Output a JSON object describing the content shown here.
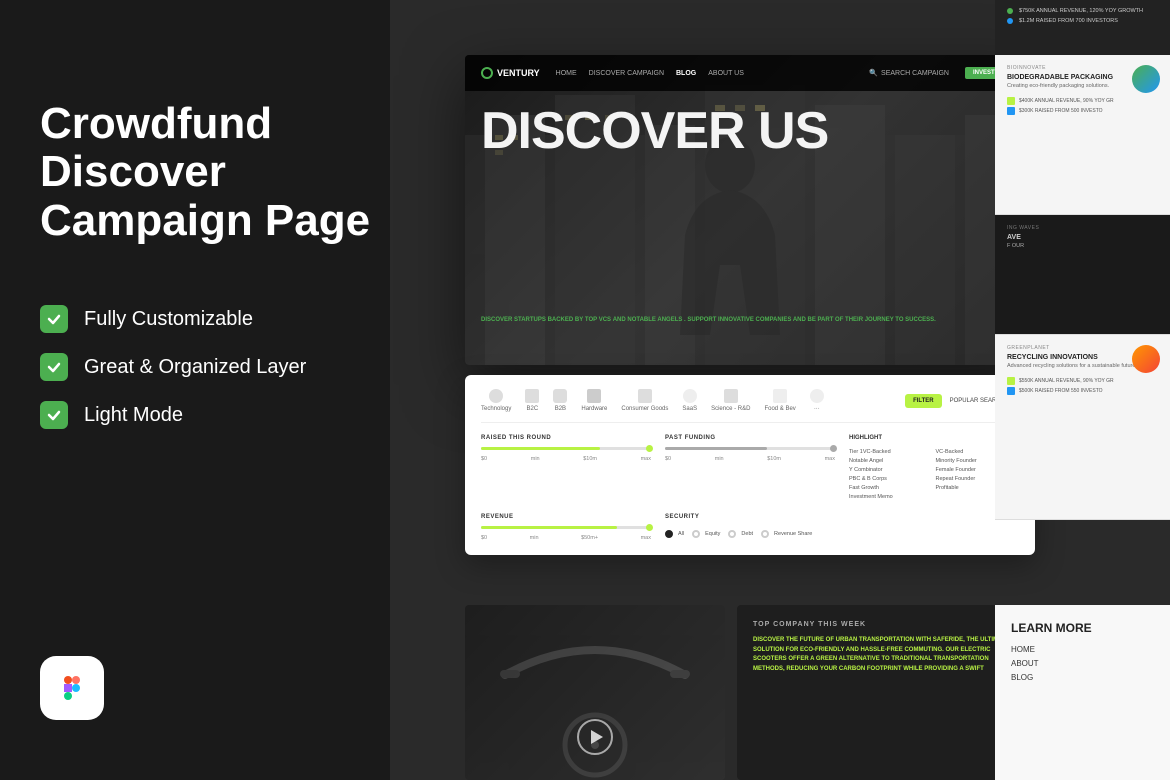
{
  "left": {
    "title": "Crowdfund\nDiscover\nCampaign Page",
    "features": [
      "Fully Customizable",
      "Great & Organized Layer",
      "Light Mode"
    ]
  },
  "hero": {
    "logo": "VENTURY",
    "nav_links": [
      "HOME",
      "DISCOVER CAMPAIGN",
      "BLOG",
      "ABOUT US"
    ],
    "search_placeholder": "SEARCH CAMPAIGN",
    "cta_button": "INVEST NOW",
    "title": "DISCOVER US",
    "subtitle_before": "DISCOVER STARTUPS BACKED BY",
    "highlight1": "TOP VCS",
    "connector": "AND",
    "highlight2": "NOTABLE ANGELS",
    "subtitle_after": ". SUPPORT INNOVATIVE COMPANIES AND BE PART OF THEIR JOURNEY TO SUCCESS."
  },
  "filter": {
    "tabs": [
      "Technology",
      "B2C",
      "B2B",
      "Hardware",
      "Consumer Goods",
      "SaaS",
      "Science - R&D",
      "Food & Bev"
    ],
    "filter_btn": "FILTER",
    "popular_searches": "POPULAR SEARCHES",
    "sections": {
      "raised": {
        "label": "RAISED THIS ROUND",
        "min_label": "$0",
        "mid_label": "min",
        "mid_val": "$10m",
        "max_label": "max"
      },
      "past_funding": {
        "label": "PAST FUNDING",
        "min_label": "$0",
        "mid_label": "min",
        "mid_val": "$10m",
        "max_label": "max"
      },
      "highlight": {
        "label": "HIGHLIGHT",
        "items": [
          "Tier 1VC-Backed",
          "VC-Backed",
          "Notable Angel",
          "Minority Founder",
          "Y Combinator",
          "Female Founder",
          "PBC & B Corps",
          "Repeat Founder",
          "Fast Growth",
          "Profitable",
          "Investment Memo",
          ""
        ]
      },
      "revenue": {
        "label": "REVENUE",
        "min_label": "$0",
        "mid_label": "min",
        "mid_val": "$50m+",
        "max_label": "max"
      },
      "security": {
        "label": "SECURITY",
        "options": [
          "All",
          "Equity",
          "Debt",
          "Revenue Share"
        ]
      }
    }
  },
  "cards": {
    "top_revenue": [
      "$750K ANNUAL REVENUE, 120% YOY GROWTH",
      "$1.2M RAISED FROM 700 INVESTORS"
    ],
    "companies": [
      {
        "tag": "BIOINNOVATE",
        "name": "BIODEGRADABLE PACKAGING",
        "desc": "Creating eco-friendly packaging solutions.",
        "stats": [
          "$400K ANNUAL REVENUE, 90% YOY GR",
          "$300K RAISED FROM 500 INVESTO"
        ]
      },
      {
        "tag": "ING WAVES",
        "name": "AVE",
        "desc": "F OUR",
        "stats": []
      },
      {
        "tag": "GREENPLANET",
        "name": "RECYCLING INNOVATIONS",
        "desc": "Advanced recycling solutions for a sustainable future.",
        "stats": [
          "$550K ANNUAL REVENUE, 90% YOY GR",
          "$500K RAISED FROM 550 INVESTO"
        ]
      }
    ]
  },
  "bottom": {
    "top_company_label": "TOP COMPANY THIS WEEK",
    "company_desc": "DISCOVER THE FUTURE OF URBAN TRANSPORTATION WITH SAFERIDE, THE ULTIMATE SOLUTION FOR ECO-FRIENDLY AND HASSLE-FREE COMMUTING. OUR ELECTRIC SCOOTERS OFFER A GREEN ALTERNATIVE TO TRADITIONAL TRANSPORTATION METHODS, REDUCING YOUR CARBON FOOTPRINT WHILE PROVIDING A SWIFT",
    "highlight_words": "SAFERIDE",
    "learn_more": {
      "title": "LEARN MORE",
      "links": [
        "HOME",
        "ABOUT",
        "BLOG"
      ]
    }
  }
}
